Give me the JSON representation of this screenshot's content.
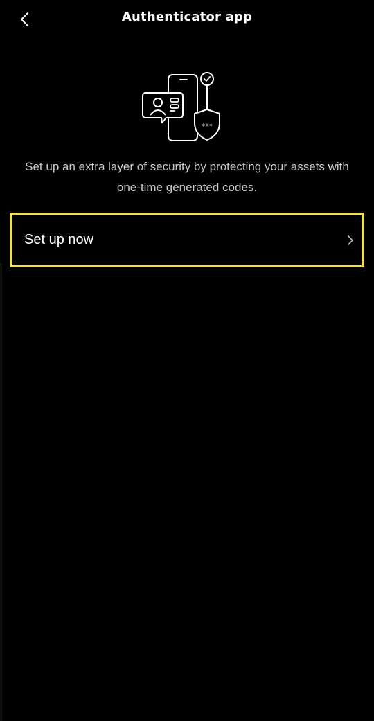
{
  "header": {
    "title": "Authenticator app",
    "back_icon": "chevron-left-icon"
  },
  "illustration": {
    "icon": "phone-id-shield-illustration",
    "shield_text": "***"
  },
  "intro": {
    "description": "Set up an extra layer of security by protecting your assets with one-time generated codes."
  },
  "actions": {
    "setup_label": "Set up now",
    "setup_icon": "chevron-right-icon"
  },
  "colors": {
    "background": "#000000",
    "text": "#ffffff",
    "muted_text": "#c8c8c8",
    "highlight_border": "#f5e42a"
  }
}
